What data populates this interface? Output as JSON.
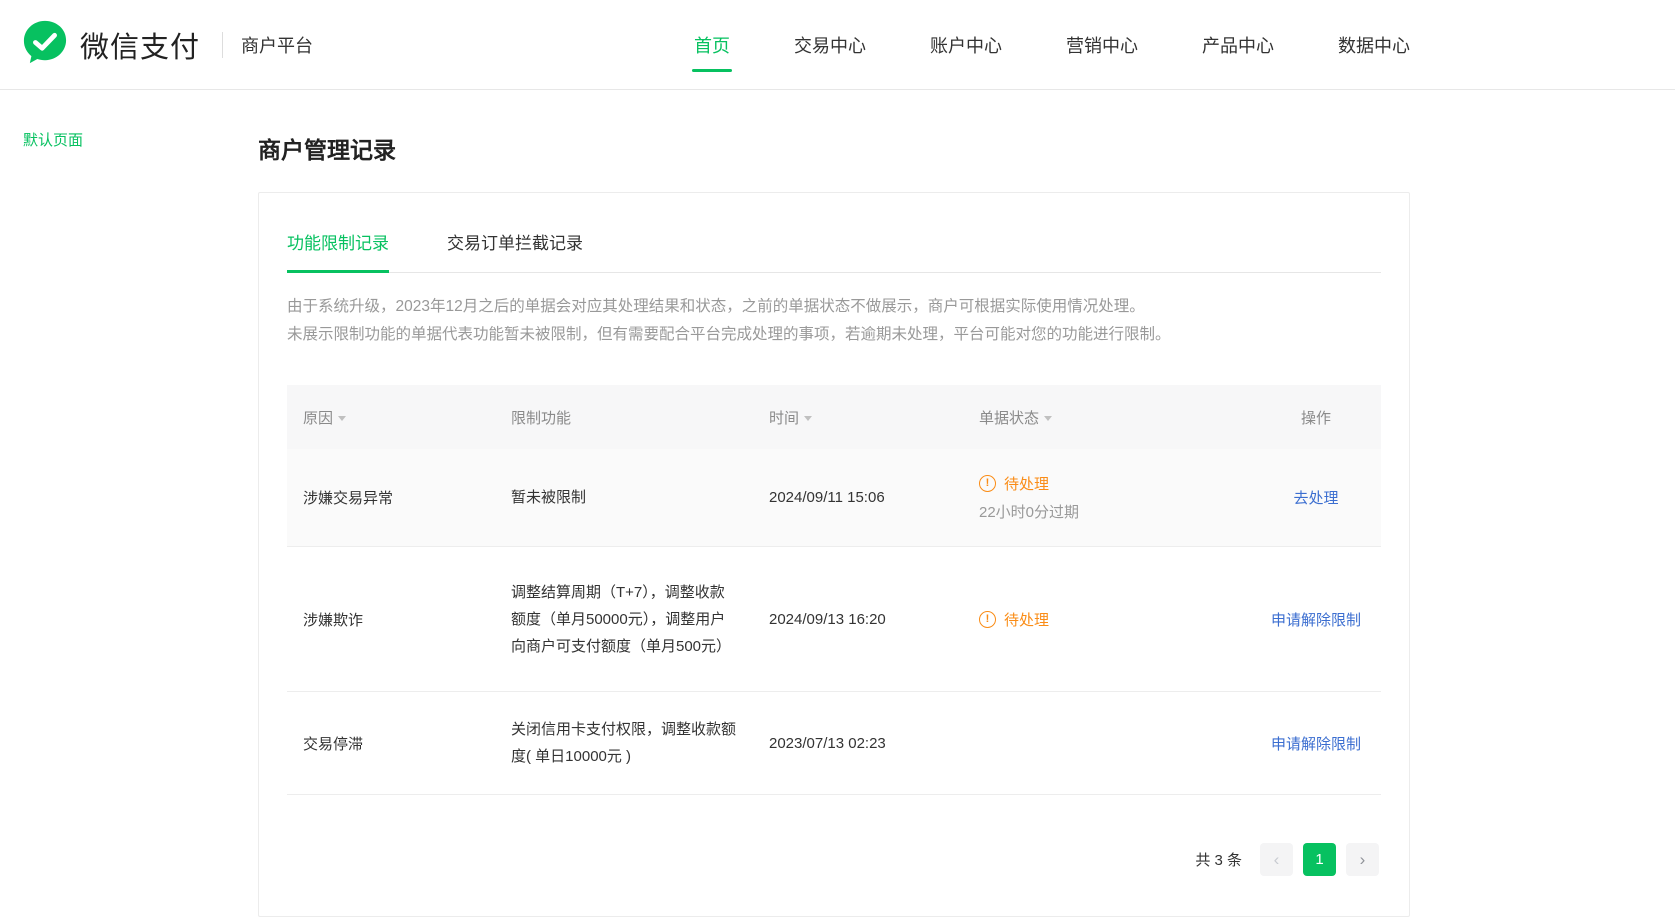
{
  "header": {
    "brand": "微信支付",
    "platform": "商户平台",
    "nav": [
      {
        "label": "首页",
        "active": true
      },
      {
        "label": "交易中心",
        "active": false
      },
      {
        "label": "账户中心",
        "active": false
      },
      {
        "label": "营销中心",
        "active": false
      },
      {
        "label": "产品中心",
        "active": false
      },
      {
        "label": "数据中心",
        "active": false
      }
    ]
  },
  "sidebar": {
    "items": [
      {
        "label": "默认页面"
      }
    ]
  },
  "main": {
    "title": "商户管理记录",
    "tabs": [
      {
        "label": "功能限制记录",
        "active": true
      },
      {
        "label": "交易订单拦截记录",
        "active": false
      }
    ],
    "notice": {
      "line1": "由于系统升级，2023年12月之后的单据会对应其处理结果和状态，之前的单据状态不做展示，商户可根据实际使用情况处理。",
      "line2": "未展示限制功能的单据代表功能暂未被限制，但有需要配合平台完成处理的事项，若逾期未处理，平台可能对您的功能进行限制。"
    },
    "table": {
      "headers": [
        "原因",
        "限制功能",
        "时间",
        "单据状态",
        "操作"
      ],
      "rows": [
        {
          "reason": "涉嫌交易异常",
          "restriction": "暂未被限制",
          "time": "2024/09/11 15:06",
          "status": "待处理",
          "status_note": "22小时0分过期",
          "action": "去处理"
        },
        {
          "reason": "涉嫌欺诈",
          "restriction": "调整结算周期（T+7），调整收款额度（单月50000元），调整用户向商户可支付额度（单月500元）",
          "time": "2024/09/13 16:20",
          "status": "待处理",
          "status_note": "",
          "action": "申请解除限制"
        },
        {
          "reason": "交易停滞",
          "restriction": "关闭信用卡支付权限，调整收款额度( 单日10000元 )",
          "time": "2023/07/13 02:23",
          "status": "",
          "status_note": "",
          "action": "申请解除限制"
        }
      ]
    },
    "pagination": {
      "total": "共 3 条",
      "prev": "‹",
      "page": "1",
      "next": "›"
    }
  },
  "colors": {
    "brand_green": "#07c160",
    "status_orange": "#fa8c16",
    "link_blue": "#3b6ed0"
  }
}
